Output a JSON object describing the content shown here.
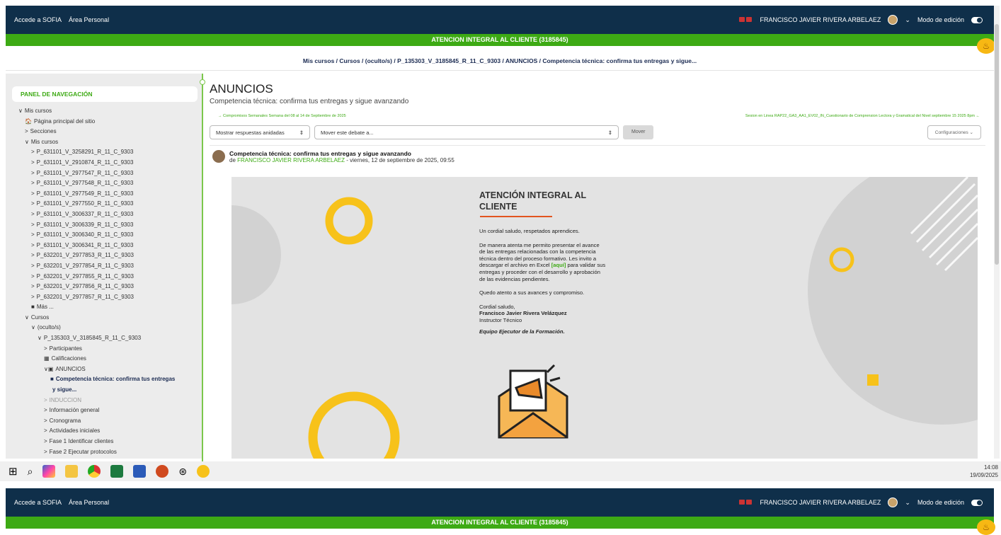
{
  "topbar": {
    "left_links": [
      "Accede a SOFIA",
      "Área Personal"
    ],
    "user_name": "FRANCISCO JAVIER RIVERA ARBELAEZ",
    "edit_mode": "Modo de edición"
  },
  "course_title": "ATENCION INTEGRAL AL CLIENTE (3185845)",
  "breadcrumb": "Mis cursos / Cursos / (oculto/s) / P_135303_V_3185845_R_11_C_9303 / ANUNCIOS / Competencia técnica: confirma tus entregas y sigue...",
  "sidebar": {
    "title": "PANEL DE NAVEGACIÓN",
    "items": [
      {
        "label": "Mis cursos",
        "prefix": "∨",
        "indent": 0
      },
      {
        "label": "Página principal del sitio",
        "prefix": "🏠",
        "indent": 1
      },
      {
        "label": "Secciones",
        "prefix": ">",
        "indent": 1
      },
      {
        "label": "Mis cursos",
        "prefix": "∨",
        "indent": 1
      },
      {
        "label": "P_631101_V_3258291_R_11_C_9303",
        "prefix": ">",
        "indent": 2
      },
      {
        "label": "P_631101_V_2910874_R_11_C_9303",
        "prefix": ">",
        "indent": 2
      },
      {
        "label": "P_631101_V_2977547_R_11_C_9303",
        "prefix": ">",
        "indent": 2
      },
      {
        "label": "P_631101_V_2977548_R_11_C_9303",
        "prefix": ">",
        "indent": 2
      },
      {
        "label": "P_631101_V_2977549_R_11_C_9303",
        "prefix": ">",
        "indent": 2
      },
      {
        "label": "P_631101_V_2977550_R_11_C_9303",
        "prefix": ">",
        "indent": 2
      },
      {
        "label": "P_631101_V_3006337_R_11_C_9303",
        "prefix": ">",
        "indent": 2
      },
      {
        "label": "P_631101_V_3006339_R_11_C_9303",
        "prefix": ">",
        "indent": 2
      },
      {
        "label": "P_631101_V_3006340_R_11_C_9303",
        "prefix": ">",
        "indent": 2
      },
      {
        "label": "P_631101_V_3006341_R_11_C_9303",
        "prefix": ">",
        "indent": 2
      },
      {
        "label": "P_632201_V_2977853_R_11_C_9303",
        "prefix": ">",
        "indent": 2
      },
      {
        "label": "P_632201_V_2977854_R_11_C_9303",
        "prefix": ">",
        "indent": 2
      },
      {
        "label": "P_632201_V_2977855_R_11_C_9303",
        "prefix": ">",
        "indent": 2
      },
      {
        "label": "P_632201_V_2977856_R_11_C_9303",
        "prefix": ">",
        "indent": 2
      },
      {
        "label": "P_632201_V_2977857_R_11_C_9303",
        "prefix": ">",
        "indent": 2
      },
      {
        "label": "Más ...",
        "prefix": "■",
        "indent": 2
      },
      {
        "label": "Cursos",
        "prefix": "∨",
        "indent": 1
      },
      {
        "label": "(oculto/s)",
        "prefix": "∨",
        "indent": 2
      },
      {
        "label": "P_135303_V_3185845_R_11_C_9303",
        "prefix": "∨",
        "indent": 3
      },
      {
        "label": "Participantes",
        "prefix": ">",
        "indent": 4
      },
      {
        "label": "Calificaciones",
        "prefix": "▦",
        "indent": 4
      },
      {
        "label": "ANUNCIOS",
        "prefix": "∨▣",
        "indent": 4
      },
      {
        "label": "Competencia técnica: confirma tus entregas",
        "prefix": "■",
        "indent": 5,
        "bold": true
      },
      {
        "label": "y sigue...",
        "prefix": "",
        "indent": 5,
        "bold": true
      },
      {
        "label": "INDUCCION",
        "prefix": ">",
        "indent": 4,
        "muted": true
      },
      {
        "label": "Información general",
        "prefix": ">",
        "indent": 4
      },
      {
        "label": "Cronograma",
        "prefix": ">",
        "indent": 4
      },
      {
        "label": "Actividades iniciales",
        "prefix": ">",
        "indent": 4
      },
      {
        "label": "Fase 1 Identificar clientes",
        "prefix": ">",
        "indent": 4
      },
      {
        "label": "Fase 2 Ejecutar protocolos",
        "prefix": ">",
        "indent": 4
      }
    ]
  },
  "main": {
    "heading": "ANUNCIOS",
    "subtitle": "Competencia técnica: confirma tus entregas y sigue avanzando",
    "prev_link": "→ Compromisos Semanales Semana del 08 al 14 de Septiembre de 2025",
    "next_link": "Sesion en Linea RAP22_GA3_AA1_EV02_IN_Cuestionario de Comprension Lectora y Gramatical del Nivel septiembre 15 2025 8pm ←",
    "display_select": "Mostrar respuestas anidadas",
    "move_select": "Mover este debate a...",
    "move_button": "Mover",
    "settings_button": "Configuraciones"
  },
  "post": {
    "title": "Competencia técnica: confirma tus entregas y sigue avanzando",
    "by": "de",
    "author": "FRANCISCO JAVIER RIVERA ARBELAEZ",
    "date": " - viernes, 12 de septiembre de 2025, 09:55"
  },
  "banner": {
    "title_line1": "ATENCIÓN INTEGRAL AL",
    "title_line2": "CLIENTE",
    "greeting": "Un cordial saludo, respetados aprendices.",
    "body_lines": [
      "De manera atenta me permito presentar el avance",
      "de las entregas relacionadas con la competencia",
      "técnica dentro del proceso formativo. Les invito a",
      "descargar el archivo en Excel ",
      "para validar sus",
      "entregas y proceder con el desarrollo y aprobación",
      "de las evidencias pendientes."
    ],
    "link_text": "[aquí]",
    "closing": "Quedo atento a sus avances y compromiso.",
    "sign1": "Cordial saludo,",
    "sign2": "Francisco Javier Rivera Velázquez",
    "sign3": "Instructor Técnico",
    "sign4": "Equipo Ejecutor de la Formación."
  },
  "clock": {
    "time": "14:08",
    "date": "19/09/2025"
  },
  "colors": {
    "navy": "#0f2f4a",
    "green": "#3daa14",
    "yellow": "#f7c21a",
    "orange": "#e2541f"
  }
}
